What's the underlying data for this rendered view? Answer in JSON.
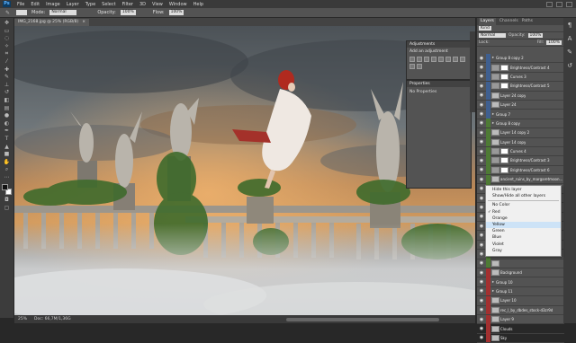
{
  "app": {
    "logo": "Ps",
    "menu": [
      "File",
      "Edit",
      "Image",
      "Layer",
      "Type",
      "Select",
      "Filter",
      "3D",
      "View",
      "Window",
      "Help"
    ]
  },
  "options_bar": {
    "mode_label": "Mode:",
    "mode_value": "Normal",
    "opacity_label": "Opacity:",
    "opacity_value": "100%",
    "flow_label": "Flow:",
    "flow_value": "100%"
  },
  "document": {
    "tab_title": "IMG_2168.jpg @ 25% (RGB/8)",
    "status_zoom": "25%",
    "status_doc": "Doc: 66,7M/1,36G"
  },
  "adjustments": {
    "header": "Adjustments",
    "title": "Add an adjustment"
  },
  "properties": {
    "header": "Properties",
    "body": "No Properties"
  },
  "layers_panel": {
    "tabs": [
      "Layers",
      "Channels",
      "Paths"
    ],
    "kind_label": "Kind",
    "blend_value": "Normal",
    "opacity_label": "Opacity:",
    "opacity_value": "100%",
    "lock_label": "Lock:",
    "fill_label": "Fill:",
    "fill_value": "100%",
    "layers": [
      {
        "name": "Group 8 copy 2",
        "color": "#3f5f8f",
        "type": "group"
      },
      {
        "name": "Brightness/Contrast 4",
        "color": "#3f5f8f",
        "type": "adj"
      },
      {
        "name": "Curves 3",
        "color": "#3f5f8f",
        "type": "adj"
      },
      {
        "name": "Brightness/Contrast 5",
        "color": "#3f5f8f",
        "type": "adj"
      },
      {
        "name": "Layer 24 copy",
        "color": "#3f5f8f",
        "type": "pixel"
      },
      {
        "name": "Layer 24",
        "color": "#3f5f8f",
        "type": "pixel"
      },
      {
        "name": "Group 7",
        "color": "#3f5f8f",
        "type": "group"
      },
      {
        "name": "Group 8 copy",
        "color": "#4e7a35",
        "type": "group"
      },
      {
        "name": "Layer 14 copy 2",
        "color": "#4e7a35",
        "type": "pixel"
      },
      {
        "name": "Layer 14 copy",
        "color": "#4e7a35",
        "type": "pixel"
      },
      {
        "name": "Curves 4",
        "color": "#4e7a35",
        "type": "adj"
      },
      {
        "name": "Brightness/Contrast 3",
        "color": "#4e7a35",
        "type": "adj"
      },
      {
        "name": "Brightness/Contrast 6",
        "color": "#4e7a35",
        "type": "adj"
      },
      {
        "name": "ancient_ruins_by_margaretmoon...",
        "color": "#4e7a35",
        "type": "pixel"
      },
      {
        "name": "Layer 22",
        "color": "#4e7a35",
        "type": "pixel"
      },
      {
        "name": "",
        "color": "#4e7a35",
        "type": "pixel"
      },
      {
        "name": "",
        "color": "#4e7a35",
        "type": "pixel"
      },
      {
        "name": "",
        "color": "#4e7a35",
        "type": "pixel"
      },
      {
        "name": "",
        "color": "#4e7a35",
        "type": "pixel"
      },
      {
        "name": "",
        "color": "#4e7a35",
        "type": "pixel"
      },
      {
        "name": "",
        "color": "#4e7a35",
        "type": "pixel"
      },
      {
        "name": "",
        "color": "#4e7a35",
        "type": "pixel"
      },
      {
        "name": "",
        "color": "#4e7a35",
        "type": "pixel"
      },
      {
        "name": "Background",
        "color": "#a23030",
        "type": "pixel"
      },
      {
        "name": "Group 10",
        "color": "#a23030",
        "type": "group"
      },
      {
        "name": "Group 11",
        "color": "#a23030",
        "type": "group"
      },
      {
        "name": "Layer 10",
        "color": "#a23030",
        "type": "pixel"
      },
      {
        "name": "rec_l_by_dbdes_stock-d3zr9d",
        "color": "#a23030",
        "type": "pixel"
      },
      {
        "name": "Layer 9",
        "color": "#a23030",
        "type": "pixel"
      },
      {
        "name": "Clouds",
        "color": "#a23030",
        "type": "pixel"
      },
      {
        "name": "Sky",
        "color": "#a23030",
        "type": "pixel"
      }
    ]
  },
  "context_menu": {
    "items": [
      "Hide this layer",
      "Show/Hide all other layers",
      "No Color",
      "Red",
      "Orange",
      "Yellow",
      "Green",
      "Blue",
      "Violet",
      "Gray"
    ],
    "checked_item": "Red",
    "highlighted_item": "Yellow"
  },
  "colors": {
    "fg": "#111111",
    "bg": "#ffffff",
    "accent_blue": "#3f5f8f",
    "accent_green": "#4e7a35",
    "accent_red": "#a23030"
  }
}
